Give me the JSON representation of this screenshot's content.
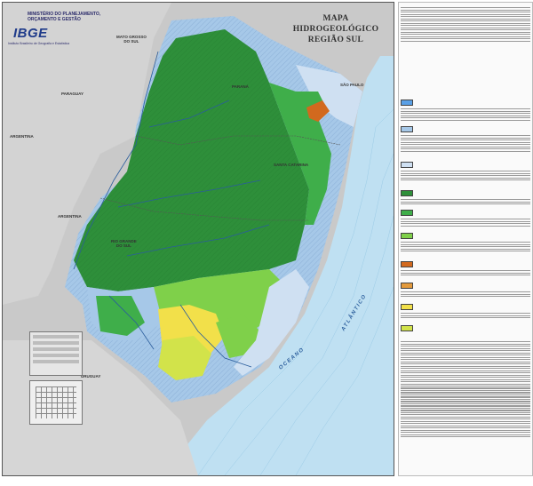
{
  "map": {
    "title_line1": "MAPA HIDROGEOLÓGICO",
    "title_line2": "REGIÃO SUL",
    "labels": {
      "mato_grosso_do_sul": "MATO GROSSO\nDO SUL",
      "sao_paulo": "SÃO PAULO",
      "paraguay": "PARAGUAY",
      "argentina_top": "ARGENTINA",
      "argentina_mid": "ARGENTINA",
      "uruguay": "URUGUAY",
      "parana": "PARANÁ",
      "santa_catarina": "SANTA CATARINA",
      "rio_grande_do_sul": "RIO GRANDE\nDO SUL",
      "oceano": "OCEANO",
      "atlantico": "ATLÂNTICO"
    },
    "colors": {
      "land_outside": "#c9c9c9",
      "sea": "#bfe0f2",
      "dark_green": "#2e8f3a",
      "mid_green": "#3fae4a",
      "light_green": "#7fd04a",
      "yellow_green": "#d2e34a",
      "yellow": "#f2e04a",
      "light_blue": "#a6c8e8",
      "pale_blue": "#cfe0f2",
      "orange": "#d2691e",
      "river": "#2a5d9c"
    }
  },
  "ibge": {
    "ministry": "MINISTÉRIO DO PLANEJAMENTO,\nORÇAMENTO E GESTÃO",
    "logo": "IBGE",
    "sub": "Instituto Brasileiro de Geografia e Estatística"
  }
}
